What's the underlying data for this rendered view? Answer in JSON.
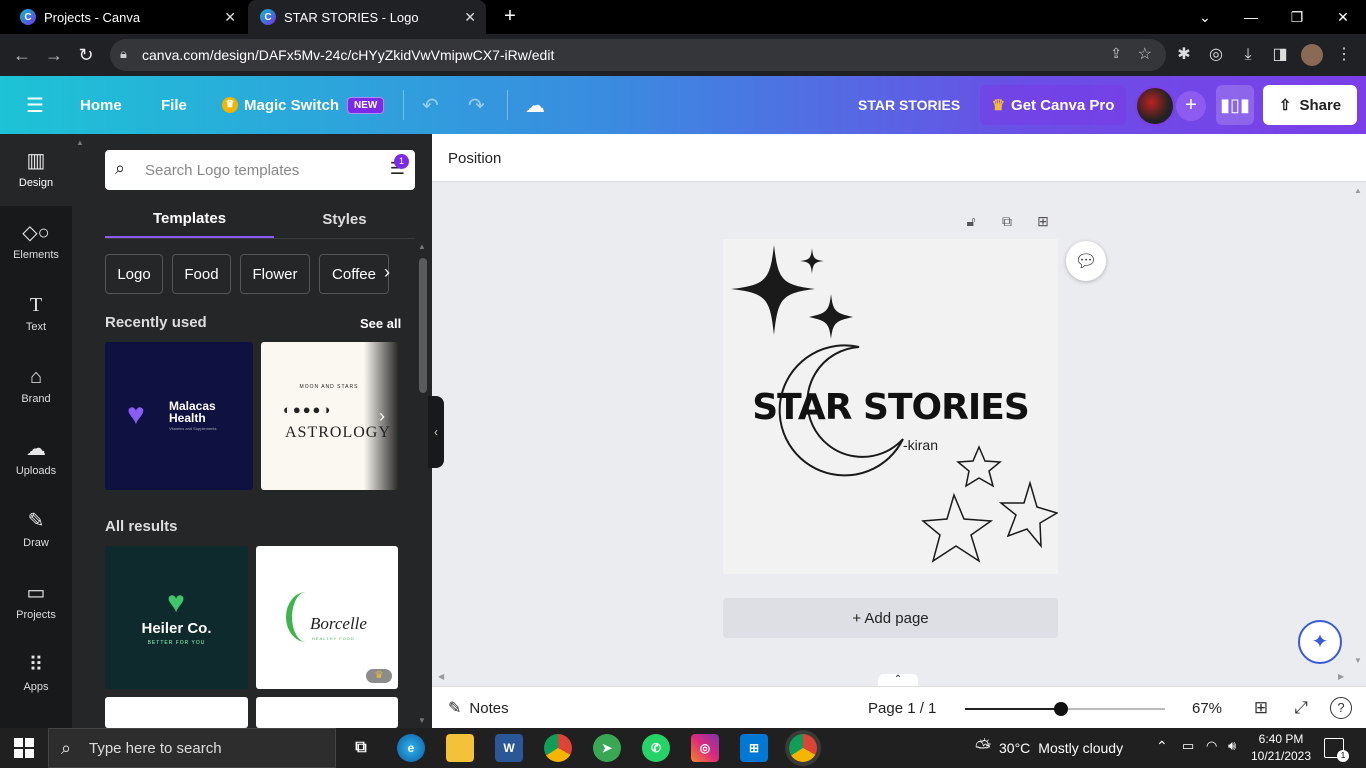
{
  "browser": {
    "tabs": [
      {
        "title": "Projects - Canva",
        "active": false
      },
      {
        "title": "STAR STORIES - Logo",
        "active": true
      }
    ],
    "url": "canva.com/design/DAFx5Mv-24c/cHYyZkidVwVmipwCX7-iRw/edit"
  },
  "header": {
    "home": "Home",
    "file": "File",
    "magic_switch": "Magic Switch",
    "new_badge": "NEW",
    "design_title": "STAR STORIES",
    "get_pro": "Get Canva Pro",
    "share": "Share",
    "colors": {
      "gradient_start": "#1dc3d6",
      "gradient_end": "#7b3ee8"
    }
  },
  "leftnav": {
    "items": [
      {
        "label": "Design",
        "icon": "layout-icon"
      },
      {
        "label": "Elements",
        "icon": "shapes-icon"
      },
      {
        "label": "Text",
        "icon": "text-icon"
      },
      {
        "label": "Brand",
        "icon": "brand-icon"
      },
      {
        "label": "Uploads",
        "icon": "upload-cloud-icon"
      },
      {
        "label": "Draw",
        "icon": "pen-icon"
      },
      {
        "label": "Projects",
        "icon": "folder-icon"
      },
      {
        "label": "Apps",
        "icon": "grid-icon"
      }
    ]
  },
  "panel": {
    "search_placeholder": "Search Logo templates",
    "filter_count": "1",
    "tabs": [
      "Templates",
      "Styles"
    ],
    "chips": [
      "Logo",
      "Food",
      "Flower",
      "Coffee"
    ],
    "recently_used": "Recently used",
    "see_all": "See all",
    "recent": [
      {
        "line1": "Malacas",
        "line2": "Health",
        "sub": "Vitamins and Supplements"
      },
      {
        "title": "ASTROLOGY",
        "arc": "MOON AND STARS"
      }
    ],
    "all_results": "All results",
    "results": [
      {
        "title": "Heiler Co.",
        "sub": "BETTER FOR YOU"
      },
      {
        "title": "Borcelle",
        "sub": "HEALTHY FOOD"
      }
    ]
  },
  "editor": {
    "position": "Position",
    "canvas": {
      "title": "STAR STORIES",
      "subtitle": "-kiran"
    },
    "add_page": "+ Add page",
    "notes": "Notes",
    "page_indicator": "Page 1 / 1",
    "zoom": "67%",
    "zoom_fraction": 0.48
  },
  "taskbar": {
    "search_placeholder": "Type here to search",
    "weather_temp": "30°C",
    "weather_text": "Mostly cloudy",
    "time": "6:40 PM",
    "date": "10/21/2023",
    "notification_count": "1"
  }
}
